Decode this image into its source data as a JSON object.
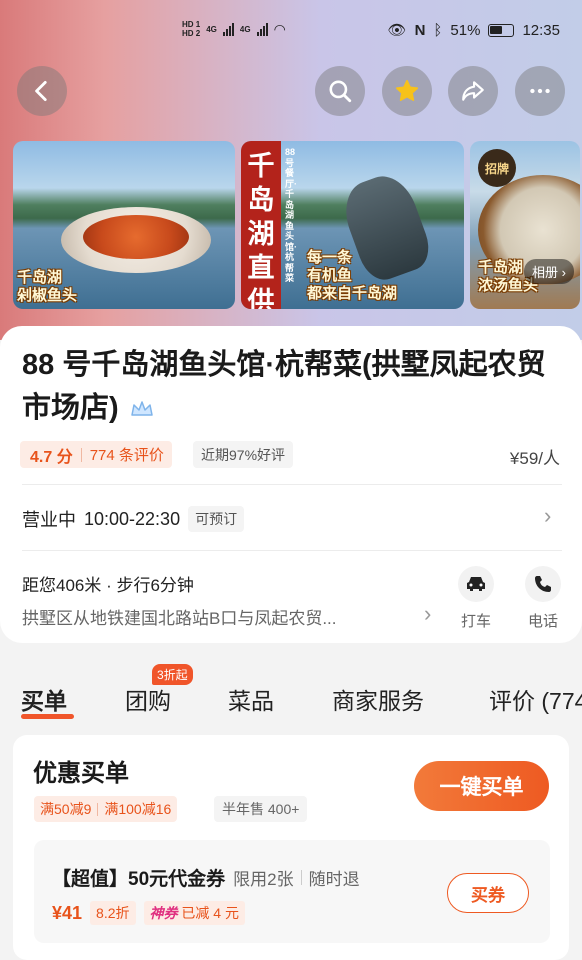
{
  "status_bar": {
    "battery": "51%",
    "time": "12:35",
    "sim1": "HD 1",
    "sim2": "HD 2",
    "network": "4G"
  },
  "nav": {
    "icons": [
      "back-icon",
      "search-icon",
      "star-icon",
      "share-icon",
      "more-icon"
    ],
    "star_color": "#f7c21a"
  },
  "gallery": {
    "photo1_caption_1": "千岛湖",
    "photo1_caption_2": "剁椒鱼头",
    "photo2_banner": "千岛湖直供",
    "photo2_side": "88号餐厅·千岛湖鱼头馆·杭帮菜",
    "photo2_caption_1": "每一条",
    "photo2_caption_2": "有机鱼",
    "photo2_caption_3": "都来自千岛湖",
    "photo3_badge": "招牌",
    "photo3_caption_1": "千岛湖",
    "photo3_caption_2": "浓汤鱼头",
    "album_label": "相册 ›"
  },
  "shop": {
    "name": "88 号千岛湖鱼头馆·杭帮菜(拱墅凤起农贸市场店)",
    "score": "4.7 分",
    "reviews": "774 条评价",
    "good_rate": "近期97%好评",
    "price": "¥59/人",
    "status": "营业中",
    "hours": "10:00-22:30",
    "reservable": "可预订",
    "distance": "距您406米 · 步行6分钟",
    "address": "拱墅区从地铁建国北路站B口与凤起农贸...",
    "taxi_label": "打车",
    "phone_label": "电话"
  },
  "tabs": {
    "items": [
      "买单",
      "团购",
      "菜品",
      "商家服务",
      "评价 (774"
    ],
    "active": "买单",
    "groupbuy_badge": "3折起",
    "accent": "#f0552a"
  },
  "buy": {
    "title": "优惠买单",
    "promo1": "满50减9",
    "promo2": "满100减16",
    "half_year_sales": "半年售 400+",
    "button": "一键买单"
  },
  "voucher": {
    "title": "【超值】50元代金券",
    "limit": "限用2张",
    "refund": "随时退",
    "price": "¥41",
    "discount": "8.2折",
    "shenquan": "神券",
    "saved": "已减 4 元",
    "button": "买券"
  }
}
